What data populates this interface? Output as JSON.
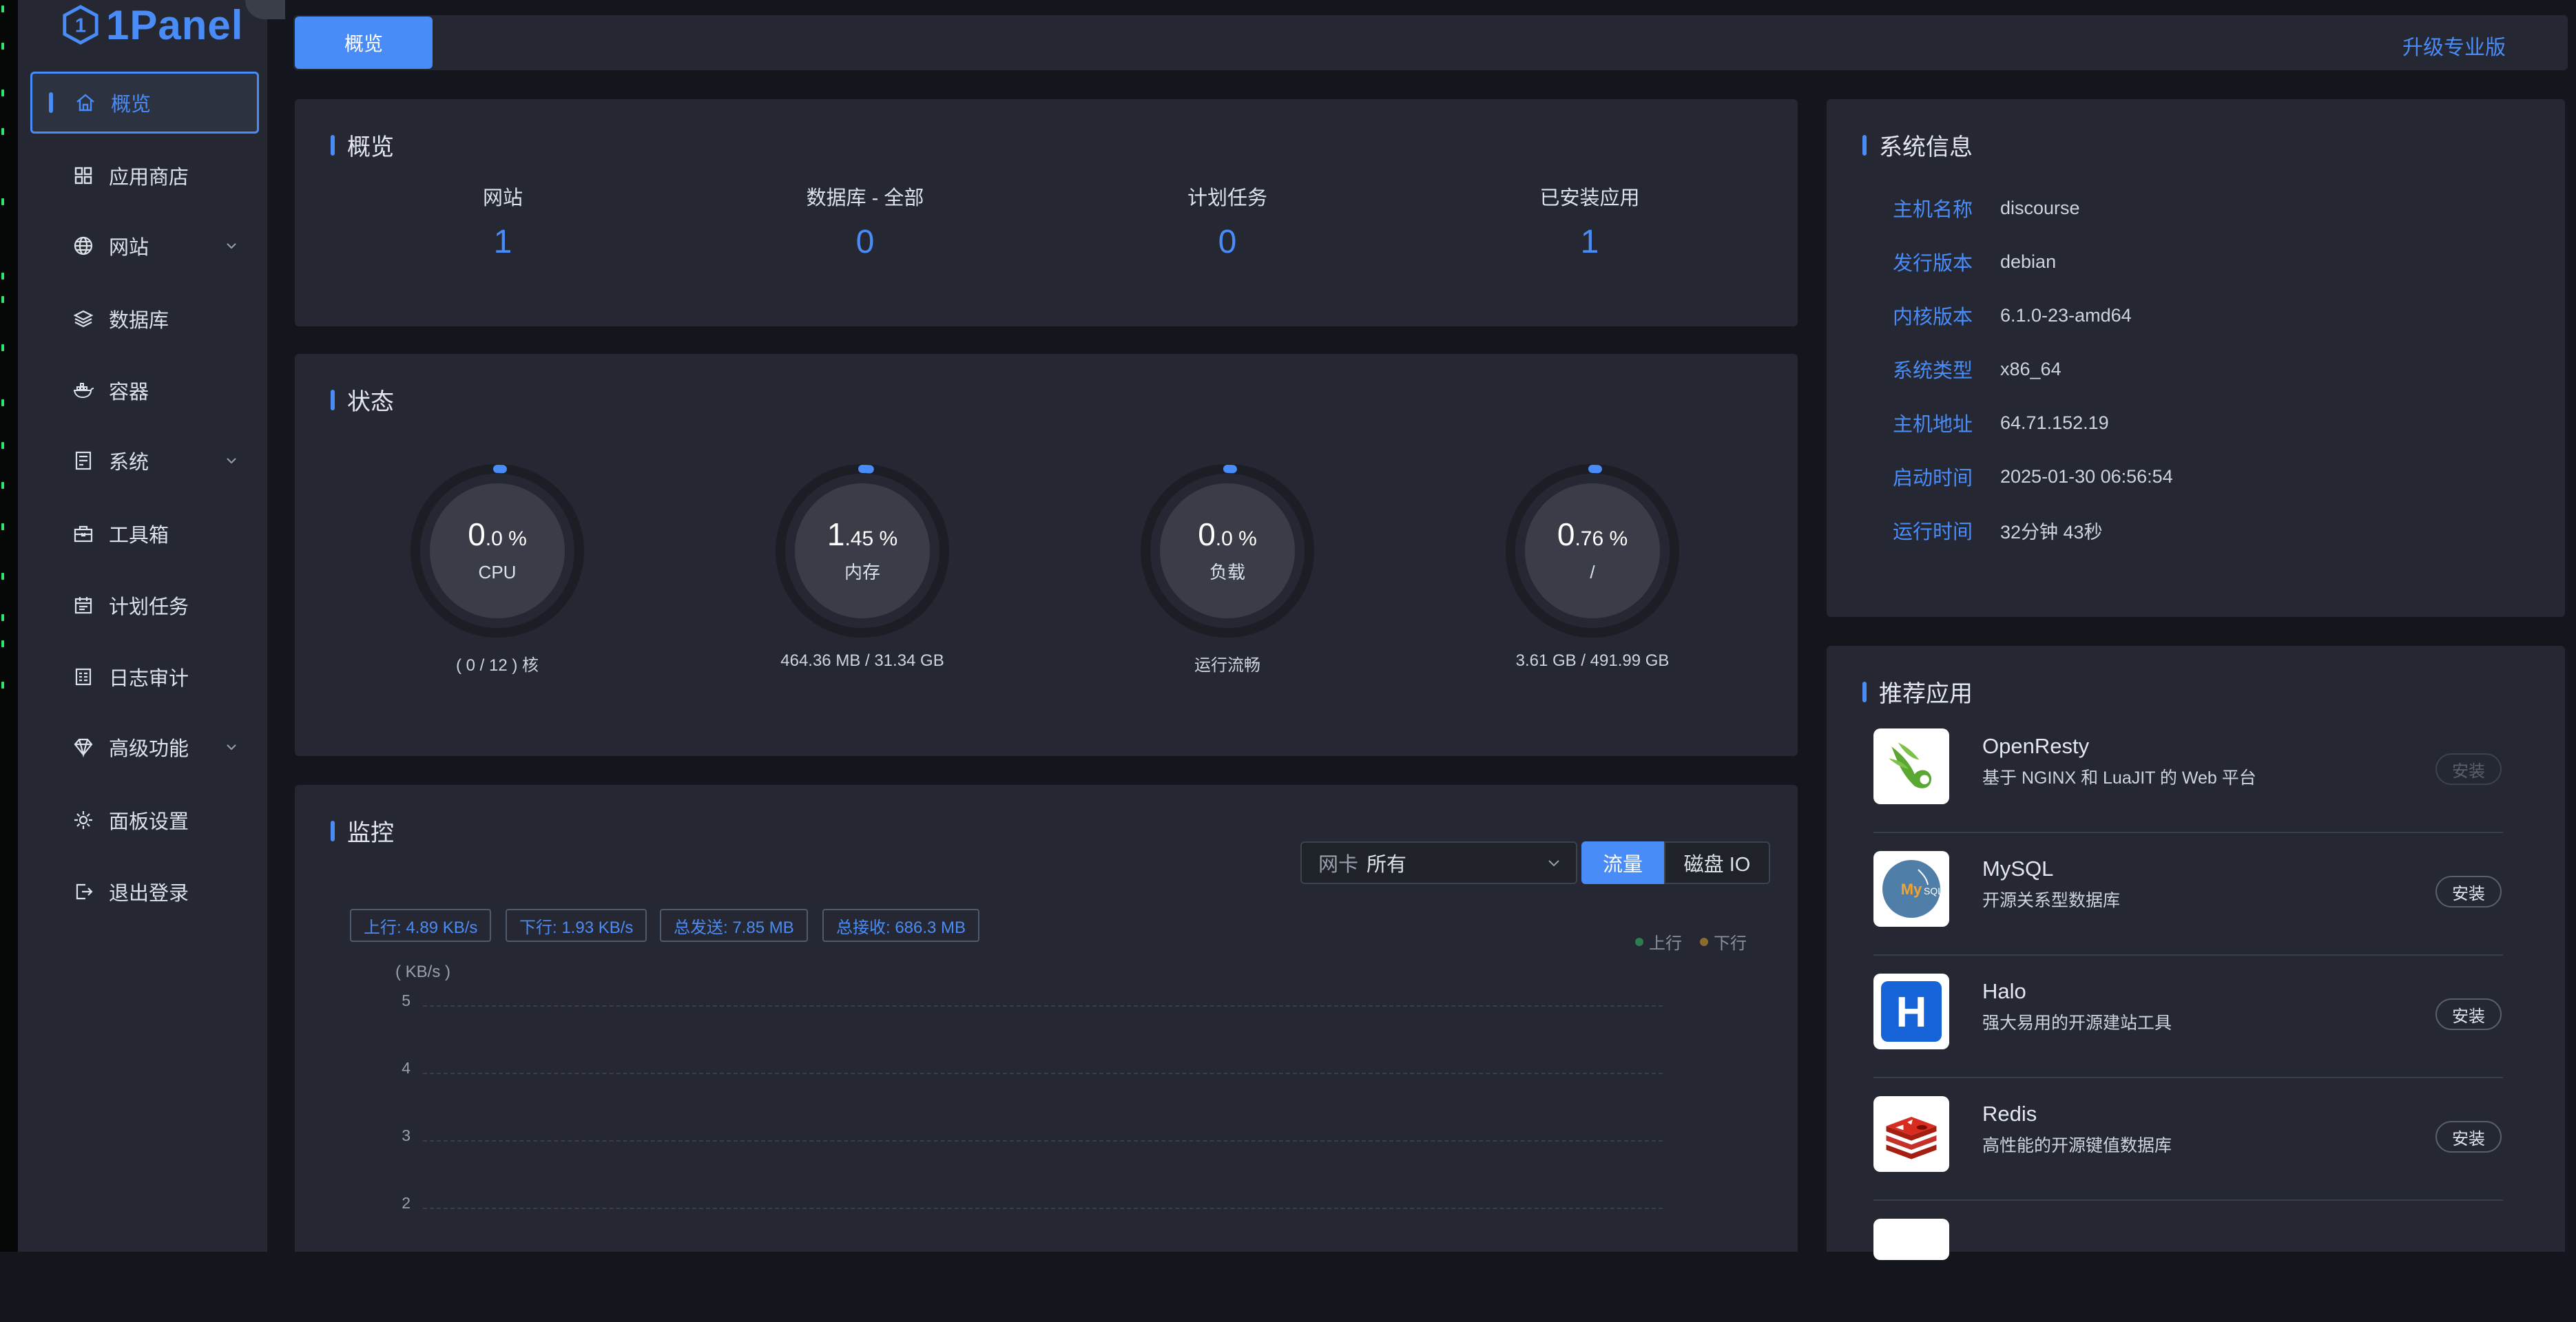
{
  "app": {
    "logo_text": "1Panel",
    "accent": "#4a8cf7"
  },
  "sidebar": {
    "items": [
      {
        "label": "概览",
        "icon": "home-icon",
        "active": true
      },
      {
        "label": "应用商店",
        "icon": "grid-icon"
      },
      {
        "label": "网站",
        "icon": "globe-icon",
        "expandable": true
      },
      {
        "label": "数据库",
        "icon": "layers-icon"
      },
      {
        "label": "容器",
        "icon": "docker-icon"
      },
      {
        "label": "系统",
        "icon": "server-icon",
        "expandable": true
      },
      {
        "label": "工具箱",
        "icon": "toolbox-icon"
      },
      {
        "label": "计划任务",
        "icon": "calendar-icon"
      },
      {
        "label": "日志审计",
        "icon": "log-icon"
      },
      {
        "label": "高级功能",
        "icon": "diamond-icon",
        "expandable": true
      },
      {
        "label": "面板设置",
        "icon": "gear-icon"
      },
      {
        "label": "退出登录",
        "icon": "logout-icon"
      }
    ]
  },
  "header": {
    "tab_label": "概览",
    "upgrade_label": "升级专业版"
  },
  "overview": {
    "title": "概览",
    "stats": [
      {
        "label": "网站",
        "value": "1"
      },
      {
        "label": "数据库 - 全部",
        "value": "0"
      },
      {
        "label": "计划任务",
        "value": "0"
      },
      {
        "label": "已安装应用",
        "value": "1"
      }
    ]
  },
  "status": {
    "title": "状态",
    "gauges": [
      {
        "int": "0",
        "dec": ".0 %",
        "label": "CPU",
        "sub": "( 0 / 12 ) 核",
        "percent": 0.0
      },
      {
        "int": "1",
        "dec": ".45 %",
        "label": "内存",
        "sub": "464.36 MB / 31.34 GB",
        "percent": 1.45
      },
      {
        "int": "0",
        "dec": ".0 %",
        "label": "负载",
        "sub": "运行流畅",
        "percent": 0.0
      },
      {
        "int": "0",
        "dec": ".76 %",
        "label": "/",
        "sub": "3.61 GB / 491.99 GB",
        "percent": 0.76
      }
    ]
  },
  "monitor": {
    "title": "监控",
    "nic_prefix": "网卡",
    "nic_value": "所有",
    "seg_traffic": "流量",
    "seg_disk": "磁盘 IO",
    "chips": [
      "上行: 4.89 KB/s",
      "下行: 1.93 KB/s",
      "总发送: 7.85 MB",
      "总接收: 686.3 MB"
    ],
    "legend_up": "上行",
    "legend_down": "下行",
    "chart_data": {
      "type": "line",
      "ylabel": "( KB/s )",
      "y_ticks": [
        "5",
        "4",
        "3",
        "2"
      ],
      "series": [
        {
          "name": "上行",
          "values": []
        },
        {
          "name": "下行",
          "values": []
        }
      ]
    }
  },
  "sysinfo": {
    "title": "系统信息",
    "rows": [
      {
        "key": "主机名称",
        "value": "discourse"
      },
      {
        "key": "发行版本",
        "value": "debian"
      },
      {
        "key": "内核版本",
        "value": "6.1.0-23-amd64"
      },
      {
        "key": "系统类型",
        "value": "x86_64"
      },
      {
        "key": "主机地址",
        "value": "64.71.152.19"
      },
      {
        "key": "启动时间",
        "value": "2025-01-30 06:56:54"
      },
      {
        "key": "运行时间",
        "value": "32分钟 43秒"
      }
    ]
  },
  "recommended": {
    "title": "推荐应用",
    "apps": [
      {
        "name": "OpenResty",
        "desc": "基于 NGINX 和 LuaJIT 的 Web 平台",
        "button": "安装",
        "disabled": true,
        "icon": "openresty-icon"
      },
      {
        "name": "MySQL",
        "desc": "开源关系型数据库",
        "button": "安装",
        "icon": "mysql-icon"
      },
      {
        "name": "Halo",
        "desc": "强大易用的开源建站工具",
        "button": "安装",
        "icon": "halo-icon"
      },
      {
        "name": "Redis",
        "desc": "高性能的开源键值数据库",
        "button": "安装",
        "icon": "redis-icon"
      }
    ]
  }
}
